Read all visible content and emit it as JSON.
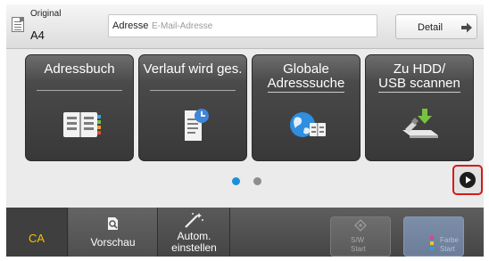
{
  "header": {
    "original_label": "Original",
    "original_size": "A4",
    "address_label": "Adresse",
    "address_placeholder": "E-Mail-Adresse",
    "address_value": "",
    "detail_label": "Detail"
  },
  "shortcuts": [
    {
      "title_line1": "Adressbuch",
      "title_line2": "",
      "icon": "address-book-icon"
    },
    {
      "title_line1": "Verlauf wird ges.",
      "title_line2": "",
      "icon": "sending-history-icon"
    },
    {
      "title_line1": "Globale",
      "title_line2": "Adresssuche",
      "icon": "global-address-search-icon"
    },
    {
      "title_line1": "Zu HDD/",
      "title_line2": "USB scannen",
      "icon": "scan-to-hdd-usb-icon"
    }
  ],
  "pager": {
    "page_count": 2,
    "current_page": 1
  },
  "footer": {
    "ca_label": "CA",
    "preview_label": "Vorschau",
    "auto_line1": "Autom.",
    "auto_line2": "einstellen",
    "bw_start_line1": "S/W",
    "bw_start_line2": "Start",
    "color_start_line1": "Farbe",
    "color_start_line2": "Start"
  },
  "colors": {
    "tile_bg": "#404040",
    "accent_blue": "#1d8fd8",
    "next_highlight": "#d61a1a",
    "ca_text": "#f2c100",
    "color_start_bg": "#7c8ea8"
  }
}
